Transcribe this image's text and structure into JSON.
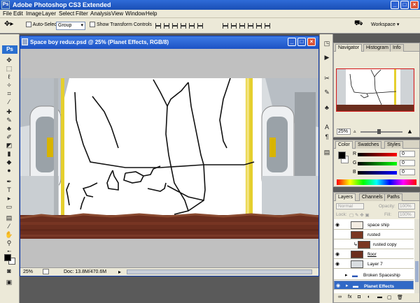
{
  "app": {
    "title": "Adobe Photoshop CS3 Extended",
    "icon": "Ps"
  },
  "menu": [
    "File",
    "Edit",
    "Image",
    "Layer",
    "Select",
    "Filter",
    "Analysis",
    "View",
    "Window",
    "Help"
  ],
  "options": {
    "auto_select_label": "Auto-Select:",
    "auto_select_value": "Group",
    "show_transform_label": "Show Transform Controls",
    "workspace_label": "Workspace ▾"
  },
  "toolbox": {
    "ps_logo": "Ps",
    "foreground_color": "#000000",
    "background_color": "#ffffff"
  },
  "document": {
    "title": "Space boy redux.psd @ 25% (Planet Effects, RGB/8)",
    "zoom": "25%",
    "doc_size": "Doc: 13.8M/470.6M"
  },
  "navigator": {
    "tabs": [
      "Navigator",
      "Histogram",
      "Info"
    ],
    "zoom": "25%"
  },
  "color_panel": {
    "tabs": [
      "Color",
      "Swatches",
      "Styles"
    ],
    "channels": [
      {
        "label": "R",
        "value": "0",
        "color": "#d22020"
      },
      {
        "label": "G",
        "value": "0",
        "color": "#20a020"
      },
      {
        "label": "B",
        "value": "0",
        "color": "#2040d0"
      }
    ]
  },
  "layers_panel": {
    "tabs": [
      "Layers",
      "Channels",
      "Paths"
    ],
    "blend_mode": "Normal",
    "opacity_label": "Opacity:",
    "opacity": "100%",
    "lock_label": "Lock:",
    "fill_label": "Fill:",
    "fill": "100%",
    "layers": [
      {
        "name": "space ship",
        "eye": true,
        "selected": false,
        "type": "ship"
      },
      {
        "name": "rusted",
        "eye": false,
        "selected": false,
        "type": "rust"
      },
      {
        "name": "rusted copy",
        "eye": false,
        "selected": false,
        "type": "rustcopy"
      },
      {
        "name": "floor",
        "eye": true,
        "selected": false,
        "type": "floor"
      },
      {
        "name": "Layer 7",
        "eye": true,
        "selected": false,
        "type": "plain"
      },
      {
        "name": "Broken Spaceship",
        "eye": false,
        "selected": false,
        "type": "folder"
      },
      {
        "name": "Planet Effects",
        "eye": true,
        "selected": true,
        "type": "folder"
      }
    ]
  }
}
